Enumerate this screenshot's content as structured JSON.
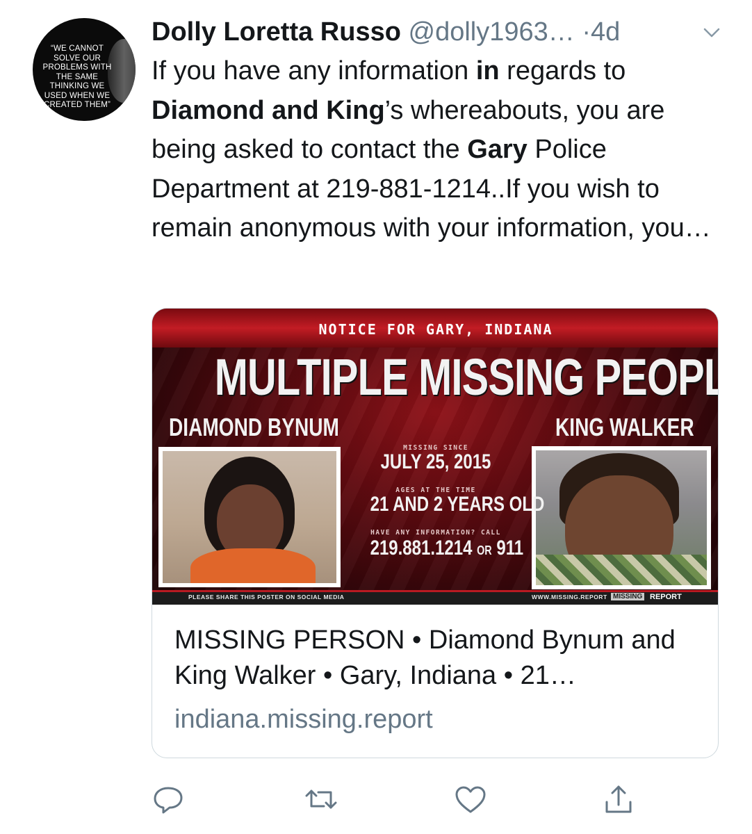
{
  "author": {
    "name": "Dolly Loretta Russo",
    "handle": "@dolly1963…",
    "dot": "·",
    "time": "4d",
    "avatar_quote": "“WE CANNOT SOLVE OUR PROBLEMS WITH THE SAME THINKING WE USED WHEN WE CREATED THEM”"
  },
  "tweet": {
    "segments": [
      {
        "text": "If you have any information ",
        "bold": false
      },
      {
        "text": "in",
        "bold": true
      },
      {
        "text": " regards to ",
        "bold": false
      },
      {
        "text": "Diamond and King",
        "bold": true
      },
      {
        "text": "’s whereabouts, you are being asked to contact the ",
        "bold": false
      },
      {
        "text": "Gary",
        "bold": true
      },
      {
        "text": " Police Department at 219-881-1214..If you wish to remain anonymous with your information, you…",
        "bold": false
      }
    ]
  },
  "card": {
    "poster": {
      "notice": "NOTICE FOR GARY, INDIANA",
      "headline": "MULTIPLE MISSING PEOPLE",
      "name_left": "DIAMOND BYNUM",
      "name_right": "KING WALKER",
      "missing_since_label": "MISSING SINCE",
      "missing_since": "JULY 25, 2015",
      "ages_label": "AGES AT THE TIME",
      "ages": "21 AND 2 YEARS OLD",
      "call_label": "HAVE ANY INFORMATION? CALL",
      "phone": "219.881.1214",
      "phone_or": "OR",
      "phone_alt": "911",
      "share_note": "PLEASE SHARE THIS POSTER ON SOCIAL MEDIA",
      "site": "WWW.MISSING.REPORT",
      "brand_box": "MISSING",
      "brand_text": "REPORT"
    },
    "title": "MISSING PERSON • Diamond Bynum and King Walker • Gary, Indiana • 21…",
    "domain": "indiana.missing.report"
  },
  "actions": {
    "reply_icon": "reply-bubble-icon",
    "retweet_icon": "retweet-arrows-icon",
    "like_icon": "heart-icon",
    "share_icon": "share-upload-icon"
  },
  "colors": {
    "text": "#14171a",
    "secondary": "#657786",
    "border": "#cfd9de",
    "poster_red": "#8e1218"
  }
}
